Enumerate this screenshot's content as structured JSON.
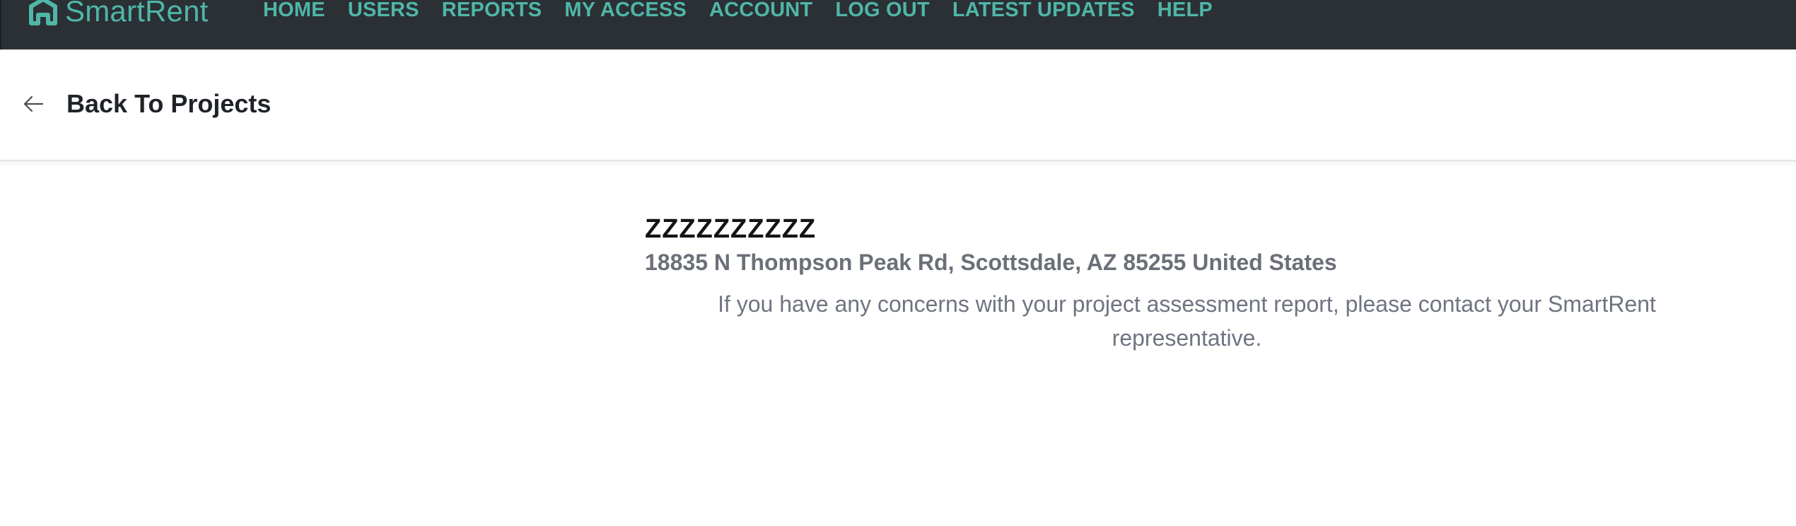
{
  "app": {
    "brand_name": "SmartRent",
    "brand_icon": "smartrent-house-logo-icon",
    "accent_color": "#4fb6a8",
    "topbar_color": "#2b3034"
  },
  "nav": {
    "items": [
      {
        "label": "HOME"
      },
      {
        "label": "USERS"
      },
      {
        "label": "REPORTS"
      },
      {
        "label": "MY ACCESS"
      },
      {
        "label": "ACCOUNT"
      },
      {
        "label": "LOG OUT"
      },
      {
        "label": "LATEST UPDATES"
      },
      {
        "label": "HELP"
      }
    ]
  },
  "subheader": {
    "back_icon": "arrow-left-icon",
    "back_label": "Back To Projects"
  },
  "project": {
    "name": "ZZZZZZZZZZ",
    "address": "18835 N Thompson Peak Rd, Scottsdale, AZ 85255 United States",
    "notice": "If you have any concerns with your project assessment report, please contact your SmartRent representative."
  }
}
